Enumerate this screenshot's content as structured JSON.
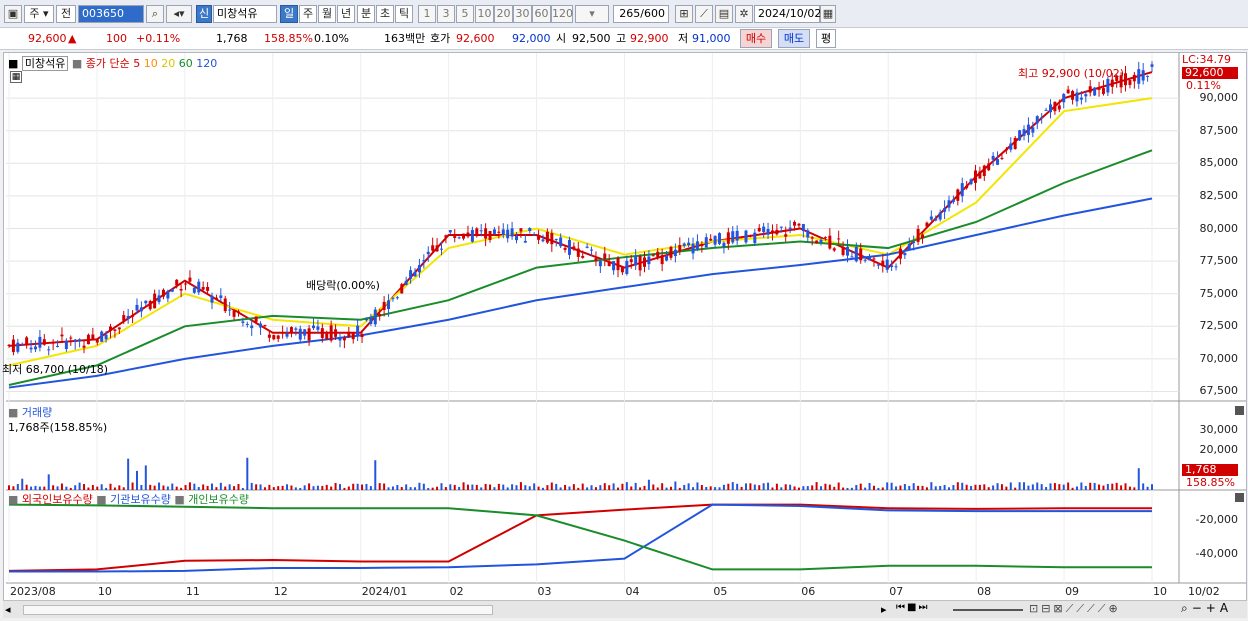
{
  "toolbar": {
    "period_unit": "주",
    "prev_label": "전",
    "stock_code": "003650",
    "new_label": "신",
    "stock_name": "미창석유",
    "tabs": [
      "일",
      "주",
      "월",
      "년",
      "분",
      "초",
      "틱"
    ],
    "intervals": [
      "1",
      "3",
      "5",
      "10",
      "20",
      "30",
      "60",
      "120"
    ],
    "count": "265",
    "count_total": "/600",
    "date": "2024/10/02"
  },
  "quote": {
    "price": "92,600",
    "change": "100",
    "change_pct": "+0.11%",
    "volume": "1,768",
    "volume_ratio": "158.85%",
    "turnover": "0.10%",
    "amount": "163백만",
    "ask_label": "호가",
    "ask": "92,600",
    "bid": "92,000",
    "open_label": "시",
    "open": "92,500",
    "high_label": "고",
    "high": "92,900",
    "low_label": "저",
    "low": "91,000",
    "buy_label": "매수",
    "sell_label": "매도",
    "avg_label": "평"
  },
  "price_panel": {
    "stock_name": "미창석유",
    "legend_prefix": "종가 단순",
    "ma_periods": [
      "5",
      "10",
      "20",
      "60",
      "120"
    ],
    "ma_colors": [
      "#d10000",
      "#ff8c00",
      "#f2e600",
      "#1a8c2a",
      "#2255dd"
    ],
    "high_note": "최고 92,900 (10/02)",
    "low_note": "최저 68,700 (10/18)",
    "dividend_note": "배당락(0.00%)",
    "last_price": "92,600",
    "last_pct": "0.11%",
    "lc": "LC:34.79",
    "y_ticks": [
      "90,000",
      "87,500",
      "85,000",
      "82,500",
      "80,000",
      "77,500",
      "75,000",
      "72,500",
      "70,000",
      "67,500"
    ]
  },
  "volume_panel": {
    "title": "거래량",
    "value": "1,768주(158.85%)",
    "y_ticks": [
      "30,000",
      "20,000",
      "10,000"
    ],
    "last_volume": "1,768",
    "last_pct": "158.85%"
  },
  "holdings_panel": {
    "legend": [
      "외국인보유수량",
      "기관보유수량",
      "개인보유수량"
    ],
    "colors": [
      "#d10000",
      "#2255dd",
      "#1a8c2a"
    ],
    "y_ticks": [
      "-20,000",
      "-40,000"
    ]
  },
  "x_axis": [
    "2023/08",
    "10",
    "11",
    "12",
    "2024/01",
    "02",
    "03",
    "04",
    "05",
    "06",
    "07",
    "08",
    "09",
    "10",
    "10/02"
  ],
  "chart_data": {
    "type": "line",
    "title": "미창석유",
    "x": [
      "2023/08",
      "2023/10",
      "2023/11",
      "2023/12",
      "2024/01",
      "2024/02",
      "2024/03",
      "2024/04",
      "2024/05",
      "2024/06",
      "2024/07",
      "2024/08",
      "2024/09",
      "2024/10"
    ],
    "series": [
      {
        "name": "5",
        "values": [
          71000,
          71500,
          76000,
          72000,
          72000,
          79500,
          79500,
          77000,
          79000,
          80000,
          77000,
          84000,
          90000,
          92000
        ]
      },
      {
        "name": "20",
        "values": [
          69500,
          71000,
          75000,
          73000,
          72500,
          78500,
          80000,
          78000,
          79000,
          79500,
          78000,
          82000,
          89000,
          90000
        ]
      },
      {
        "name": "60",
        "values": [
          68000,
          69500,
          72500,
          73300,
          73000,
          74500,
          77000,
          77800,
          78500,
          79000,
          78500,
          80500,
          83500,
          86000
        ]
      },
      {
        "name": "120",
        "values": [
          67800,
          68700,
          70000,
          71000,
          71800,
          73000,
          74500,
          75500,
          76500,
          77200,
          78000,
          79500,
          81000,
          82300
        ]
      }
    ],
    "ylim": [
      67000,
      93000
    ]
  }
}
